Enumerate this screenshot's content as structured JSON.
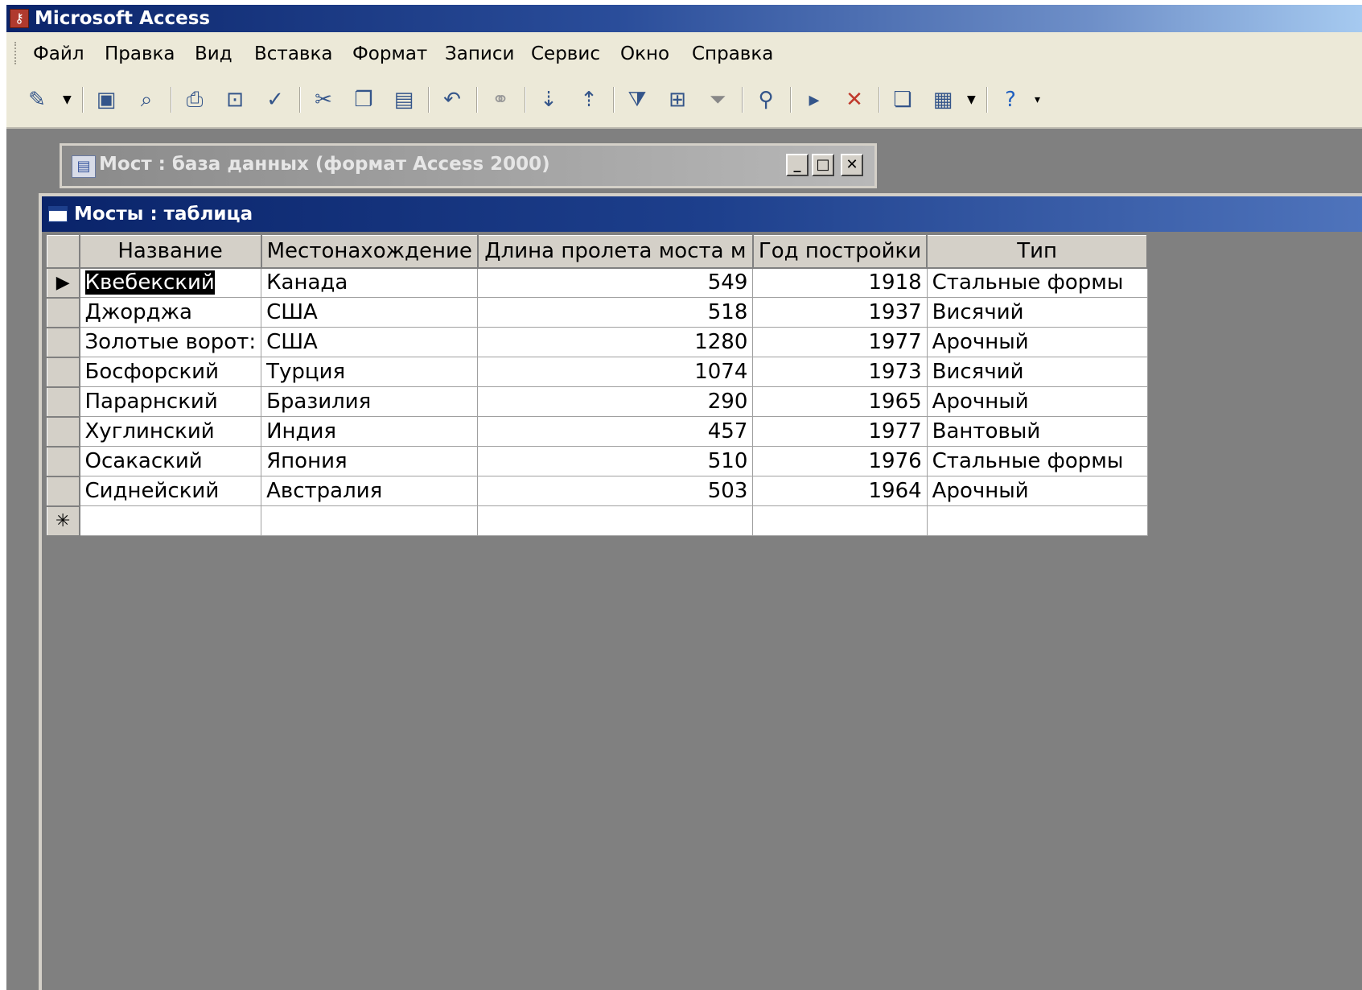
{
  "app": {
    "title": "Microsoft Access",
    "icon": "access-key-icon"
  },
  "menu": [
    "Файл",
    "Правка",
    "Вид",
    "Вставка",
    "Формат",
    "Записи",
    "Сервис",
    "Окно",
    "Справка"
  ],
  "db_window": {
    "title": "Мост : база данных (формат Access 2000)"
  },
  "table_window": {
    "title": "Мосты : таблица"
  },
  "table": {
    "headers": [
      "Название",
      "Местонахождение",
      "Длина пролета моста м",
      "Год постройки",
      "Тип"
    ],
    "rows": [
      [
        "Квебекский",
        "Канада",
        "549",
        "1918",
        "Стальные формы"
      ],
      [
        "Джорджа",
        "США",
        "518",
        "1937",
        "Висячий"
      ],
      [
        "Золотые ворот:",
        "США",
        "1280",
        "1977",
        "Арочный"
      ],
      [
        "Босфорский",
        "Турция",
        "1074",
        "1973",
        "Висячий"
      ],
      [
        "Парарнский",
        "Бразилия",
        "290",
        "1965",
        "Арочный"
      ],
      [
        "Хуглинский",
        "Индия",
        "457",
        "1977",
        "Вантовый"
      ],
      [
        "Осакаский",
        "Япония",
        "510",
        "1976",
        "Стальные формы"
      ],
      [
        "Сиднейский",
        "Австралия",
        "503",
        "1964",
        "Арочный"
      ]
    ],
    "current_row_marker": "▶",
    "new_row_marker": "✳"
  }
}
